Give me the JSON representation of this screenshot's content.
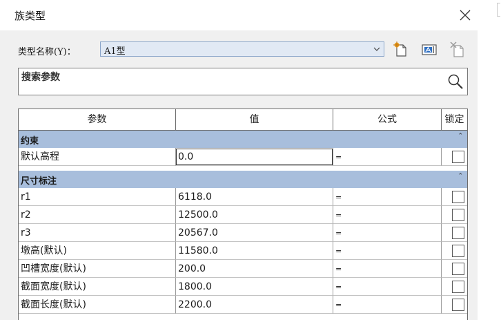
{
  "window": {
    "title": "族类型"
  },
  "type": {
    "label": "类型名称(Y)：",
    "value": "A1型"
  },
  "search": {
    "placeholder": "搜索参数"
  },
  "table": {
    "headers": [
      "参数",
      "值",
      "公式",
      "锁定"
    ],
    "groups": [
      {
        "name": "约束",
        "rows": [
          {
            "param": "默认高程",
            "value": "0.0",
            "formula": "=",
            "locked": false
          }
        ]
      },
      {
        "name": "尺寸标注",
        "rows": [
          {
            "param": "r1",
            "value": "6118.0",
            "formula": "=",
            "locked": false
          },
          {
            "param": "r2",
            "value": "12500.0",
            "formula": "=",
            "locked": false
          },
          {
            "param": "r3",
            "value": "20567.0",
            "formula": "=",
            "locked": false
          },
          {
            "param": "墩高(默认)",
            "value": "11580.0",
            "formula": "=",
            "locked": false
          },
          {
            "param": "凹槽宽度(默认)",
            "value": "200.0",
            "formula": "=",
            "locked": false
          },
          {
            "param": "截面宽度(默认)",
            "value": "1800.0",
            "formula": "=",
            "locked": false
          },
          {
            "param": "截面长度(默认)",
            "value": "2200.0",
            "formula": "=",
            "locked": false
          }
        ]
      }
    ]
  },
  "icons": {
    "close": "close-icon",
    "dropdown": "chevron-down-icon",
    "new_type": "new-type-icon",
    "rename_type": "rename-type-icon",
    "delete_type": "delete-type-icon",
    "search": "search-icon",
    "collapse": "collapse-icon"
  },
  "colors": {
    "group_header": "#a8bedc",
    "select_bg": "#e1e9f4",
    "dialog_bg": "#f0f0f0"
  }
}
